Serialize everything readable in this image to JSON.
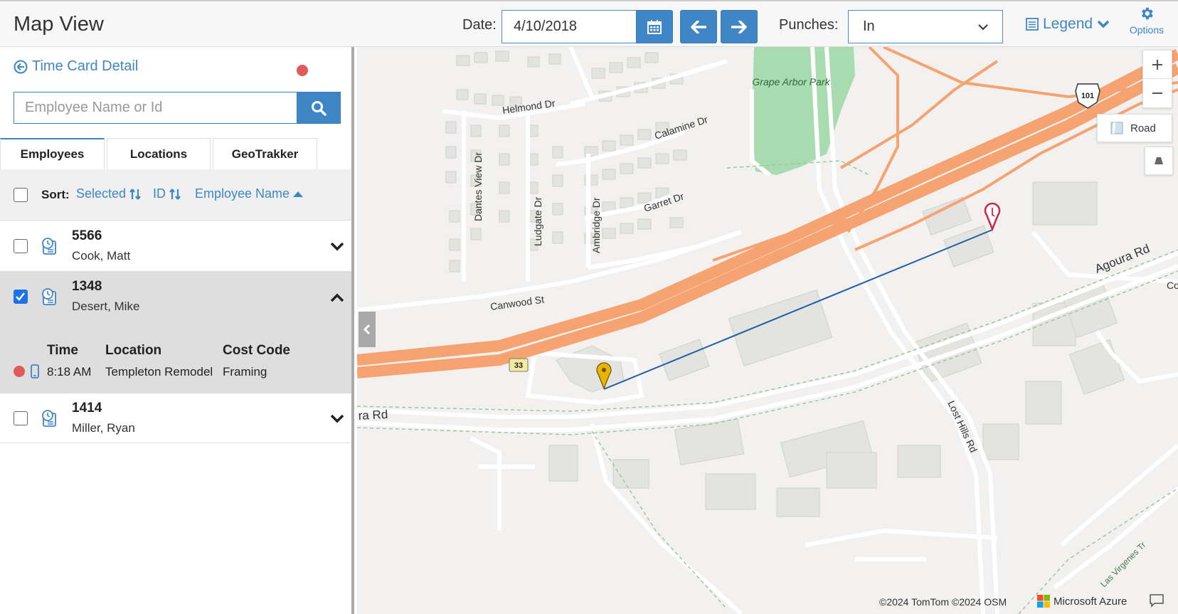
{
  "header": {
    "title": "Map View",
    "date_label": "Date:",
    "date_value": "4/10/2018",
    "punches_label": "Punches:",
    "punches_value": "In",
    "legend_label": "Legend",
    "options_label": "Options"
  },
  "sidebar": {
    "back_link": "Time Card Detail",
    "search_placeholder": "Employee Name or Id",
    "tabs": [
      {
        "label": "Employees",
        "active": true
      },
      {
        "label": "Locations",
        "active": false
      },
      {
        "label": "GeoTrakker",
        "active": false
      }
    ],
    "sort": {
      "label": "Sort:",
      "options": [
        "Selected",
        "ID",
        "Employee Name"
      ]
    },
    "employees": [
      {
        "id": "5566",
        "name": "Cook, Matt",
        "checked": false,
        "expanded": false
      },
      {
        "id": "1348",
        "name": "Desert, Mike",
        "checked": true,
        "expanded": true,
        "detail": {
          "headers": [
            "Time",
            "Location",
            "Cost Code"
          ],
          "time": "8:18 AM",
          "location": "Templeton Remodel",
          "cost_code": "Framing"
        }
      },
      {
        "id": "1414",
        "name": "Miller, Ryan",
        "checked": false,
        "expanded": false
      }
    ]
  },
  "map": {
    "labels": {
      "park": "Grape Arbor Park",
      "helmond": "Helmond Dr",
      "calamine": "Calamine Dr",
      "garret": "Garret Dr",
      "dantes": "Dantes View Dr",
      "ludgate": "Ludgate Dr",
      "ambridge": "Ambridge Dr",
      "canwood": "Canwood St",
      "agoura_rd": "Agoura Rd",
      "agoura_partial": "ra Rd",
      "lost_hills": "Lost Hills Rd",
      "virgenes": "Las Virgenes Tr",
      "hwy101": "101",
      "hwy33": "33",
      "co": "Co"
    },
    "road_button": "Road",
    "attribution": "©2024 TomTom ©2024 OSM",
    "provider": "Microsoft Azure"
  },
  "colors": {
    "accent": "#3f86c6",
    "highway": "#f5a370",
    "park": "#a8dcb0",
    "route_line": "#1f5fa8",
    "pin_yellow": "#e8b400",
    "pin_red": "#c8284a"
  }
}
